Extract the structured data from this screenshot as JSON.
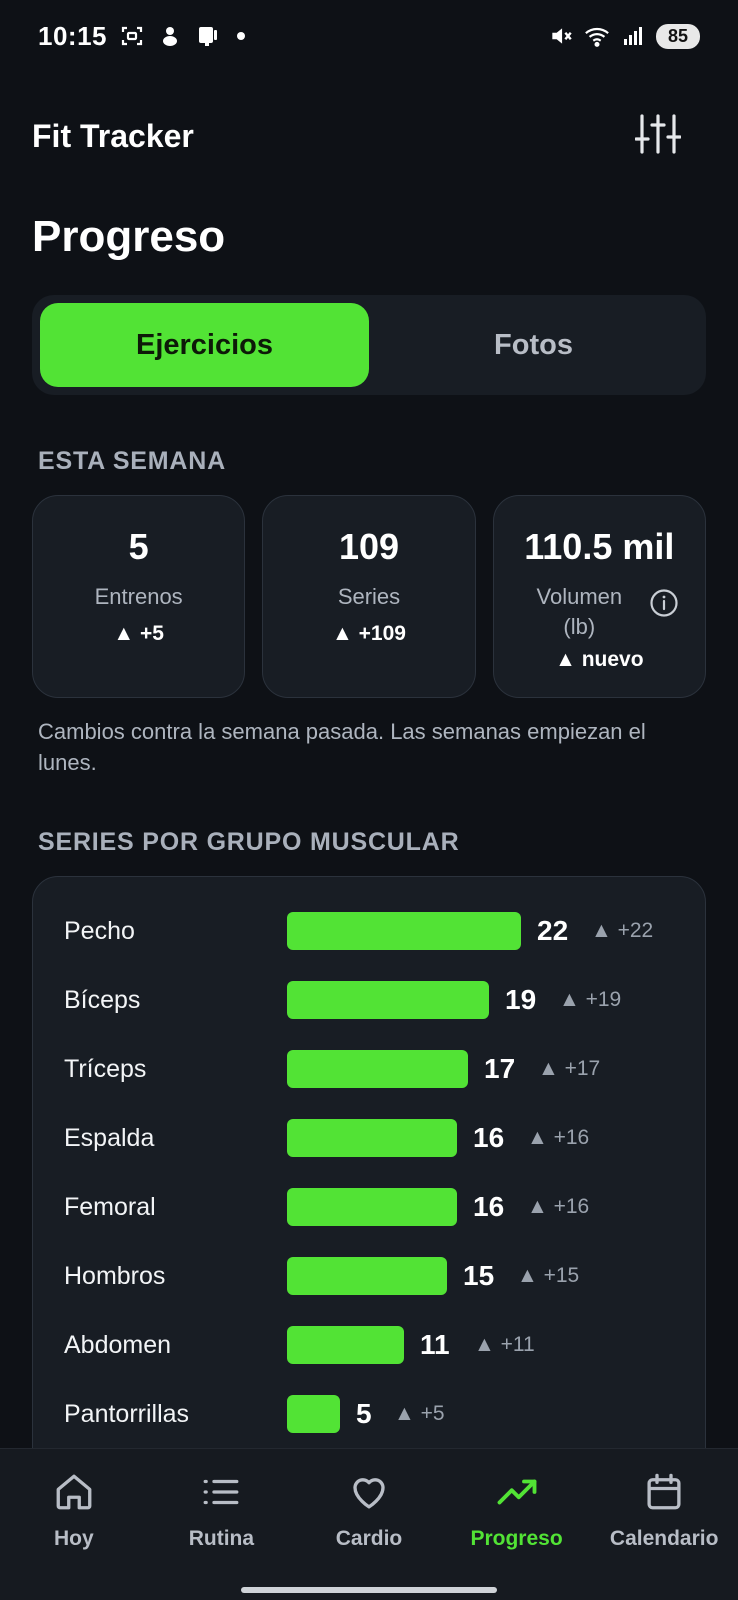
{
  "status_bar": {
    "time": "10:15",
    "battery": "85",
    "left_icons": [
      "screenshot-icon",
      "notification-icon",
      "sim-icon"
    ],
    "right_icons": [
      "mute-icon",
      "wifi-icon",
      "signal-icon"
    ]
  },
  "header": {
    "app_title": "Fit Tracker",
    "settings_icon": "sliders-icon"
  },
  "page": {
    "title": "Progreso"
  },
  "tabs": [
    {
      "label": "Ejercicios",
      "active": true
    },
    {
      "label": "Fotos",
      "active": false
    }
  ],
  "this_week": {
    "section_title": "ESTA SEMANA",
    "stats": [
      {
        "value": "5",
        "label": "Entrenos",
        "change": "▲ +5"
      },
      {
        "value": "109",
        "label": "Series",
        "change": "▲ +109"
      },
      {
        "value": "110.5 mil",
        "label": "Volumen (lb)",
        "change": "▲ nuevo"
      }
    ],
    "note": "Cambios contra la semana pasada. Las semanas empiezan el lunes."
  },
  "muscle_groups": {
    "section_title": "SERIES POR GRUPO MUSCULAR",
    "accent_color": "#52e335",
    "max_value": 22,
    "rows": [
      {
        "label": "Pecho",
        "value": 22,
        "value_text": "22",
        "delta": "▲ +22"
      },
      {
        "label": "Bíceps",
        "value": 19,
        "value_text": "19",
        "delta": "▲ +19"
      },
      {
        "label": "Tríceps",
        "value": 17,
        "value_text": "17",
        "delta": "▲ +17"
      },
      {
        "label": "Espalda",
        "value": 16,
        "value_text": "16",
        "delta": "▲ +16"
      },
      {
        "label": "Femoral",
        "value": 16,
        "value_text": "16",
        "delta": "▲ +16"
      },
      {
        "label": "Hombros",
        "value": 15,
        "value_text": "15",
        "delta": "▲ +15"
      },
      {
        "label": "Abdomen",
        "value": 11,
        "value_text": "11",
        "delta": "▲ +11"
      },
      {
        "label": "Pantorrillas",
        "value": 5,
        "value_text": "5",
        "delta": "▲ +5"
      }
    ]
  },
  "bottom_nav": {
    "items": [
      {
        "label": "Hoy",
        "icon": "home-icon",
        "active": false
      },
      {
        "label": "Rutina",
        "icon": "list-icon",
        "active": false
      },
      {
        "label": "Cardio",
        "icon": "heart-icon",
        "active": false
      },
      {
        "label": "Progreso",
        "icon": "trending-up-icon",
        "active": true
      },
      {
        "label": "Calendario",
        "icon": "calendar-icon",
        "active": false
      }
    ]
  }
}
